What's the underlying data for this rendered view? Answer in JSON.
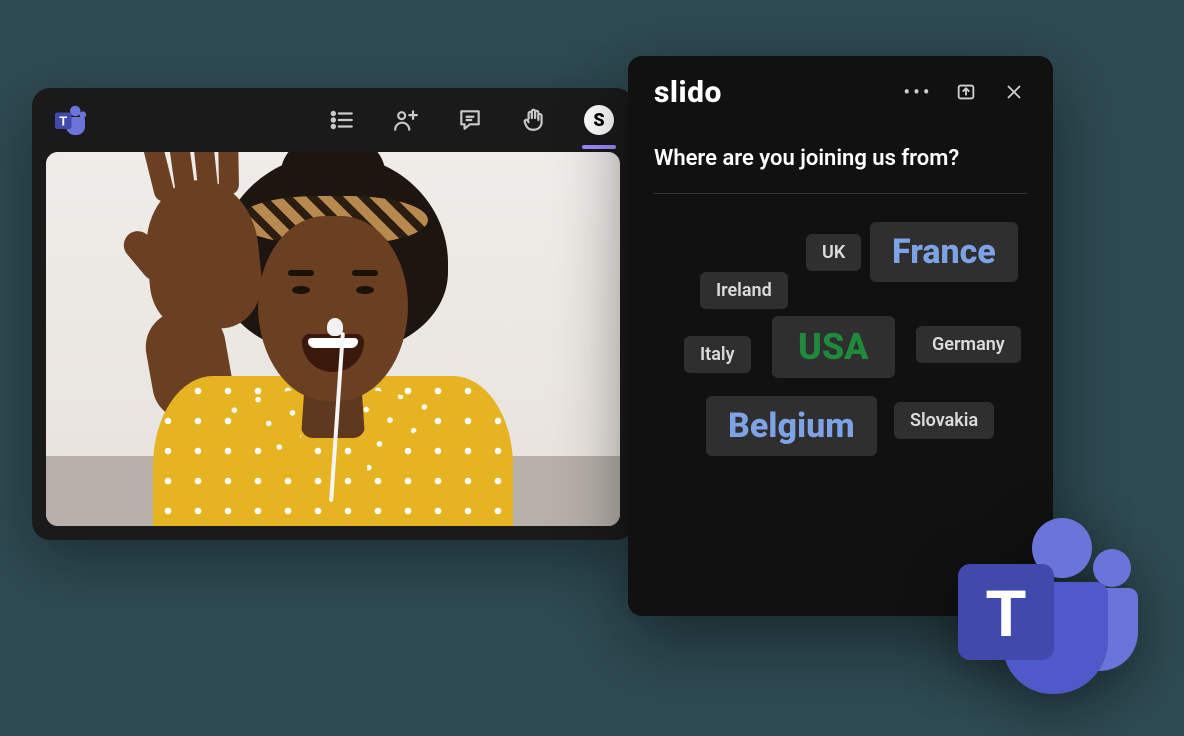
{
  "teams": {
    "toolbar": {
      "slido_badge_letter": "S"
    }
  },
  "slido": {
    "brand": "slido",
    "question": "Where are you joining us from?",
    "wordcloud": [
      {
        "key": "uk",
        "label": "UK",
        "size": "sm"
      },
      {
        "key": "france",
        "label": "France",
        "size": "lg"
      },
      {
        "key": "ireland",
        "label": "Ireland",
        "size": "sm"
      },
      {
        "key": "italy",
        "label": "Italy",
        "size": "sm"
      },
      {
        "key": "usa",
        "label": "USA",
        "size": "xl"
      },
      {
        "key": "germany",
        "label": "Germany",
        "size": "sm"
      },
      {
        "key": "belgium",
        "label": "Belgium",
        "size": "lg"
      },
      {
        "key": "slovakia",
        "label": "Slovakia",
        "size": "sm"
      }
    ]
  },
  "colors": {
    "teams_purple": "#5059c9",
    "teams_purple_dark": "#4249ad",
    "slido_green": "#1f8a3b",
    "cloud_blue": "#7ea2e6"
  }
}
